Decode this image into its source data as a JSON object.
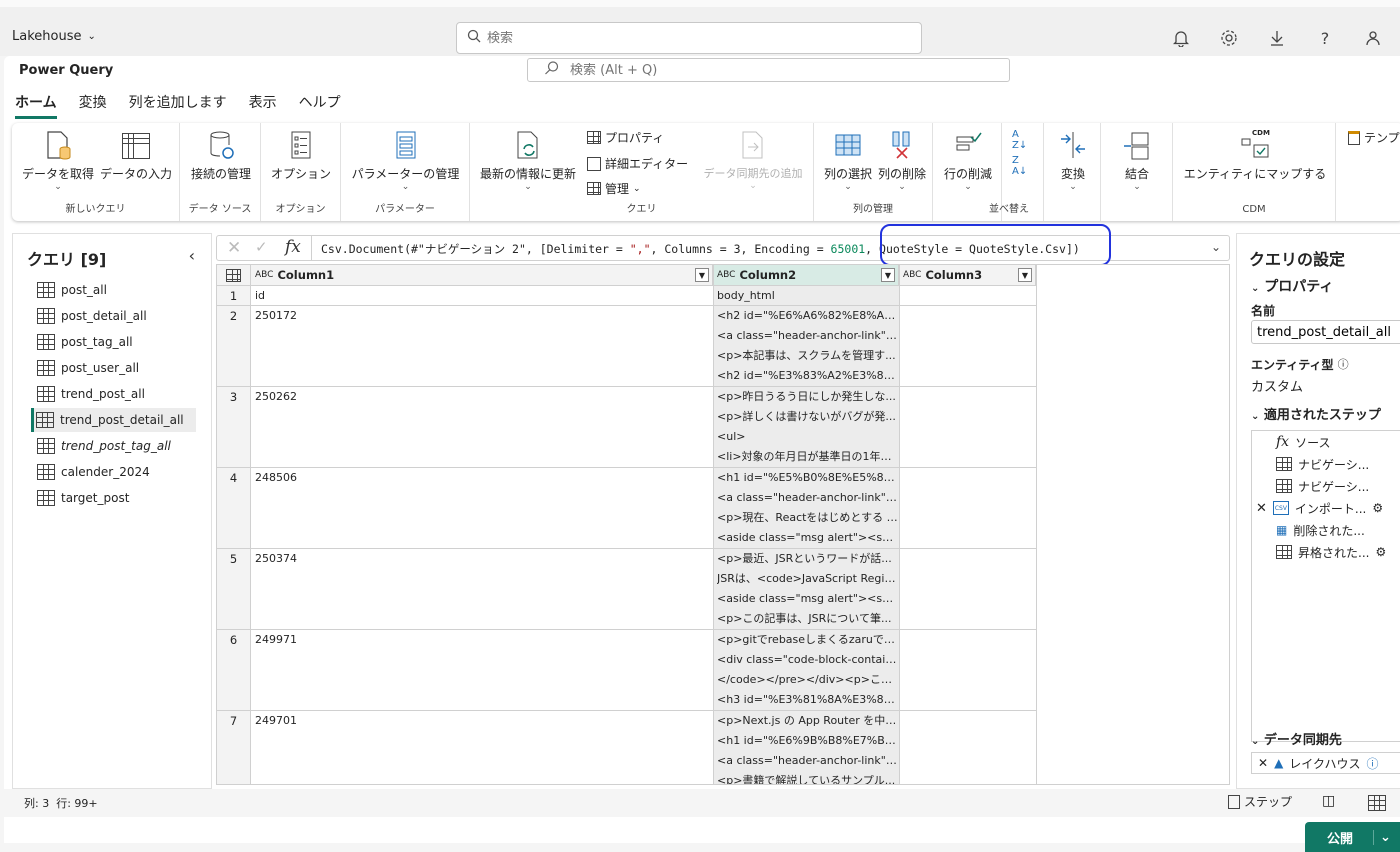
{
  "topbar": {
    "workspace": "Lakehouse",
    "search_placeholder": "検索"
  },
  "pq": {
    "title": "Power Query",
    "search_placeholder": "検索 (Alt + Q)"
  },
  "tabs": [
    "ホーム",
    "変換",
    "列を追加します",
    "表示",
    "ヘルプ"
  ],
  "ribbon": {
    "get_data": "データを取得",
    "enter_data": "データの入力",
    "group_new_query": "新しいクエリ",
    "manage_connections": "接続の管理",
    "group_data_source": "データ ソース",
    "options": "オプション",
    "group_options": "オプション",
    "manage_params": "パラメーターの管理",
    "group_params": "パラメーター",
    "refresh": "最新の情報に更新",
    "properties": "プロパティ",
    "advanced_editor": "詳細エディター",
    "manage": "管理",
    "add_sync_dest": "データ同期先の追加",
    "group_query": "クエリ",
    "choose_columns": "列の選択",
    "remove_columns": "列の削除",
    "group_manage_columns": "列の管理",
    "reduce_rows": "行の削減",
    "group_sort": "並べ替え",
    "transform": "変換",
    "combine": "結合",
    "map_entity": "エンティティにマップする",
    "group_cdm": "CDM",
    "cdm_badge": "CDM",
    "template": "テンプ"
  },
  "queries": {
    "title": "クエリ [9]",
    "items": [
      "post_all",
      "post_detail_all",
      "post_tag_all",
      "post_user_all",
      "trend_post_all",
      "trend_post_detail_all",
      "trend_post_tag_all",
      "calender_2024",
      "target_post"
    ]
  },
  "formula": {
    "fx": "fx",
    "p1": "Csv.Document(#\"ナビゲーション 2\", [Delimiter = ",
    "p2": "\",\"",
    "p3": ", Columns = 3, Encoding = ",
    "p4": "65001",
    "p5": ", QuoteStyle = QuoteStyle.Csv])"
  },
  "grid": {
    "type_badge": "ABC",
    "columns": [
      "Column1",
      "Column2",
      "Column3"
    ],
    "rows": [
      {
        "n": "1",
        "c1": "id",
        "c2": [
          "body_html"
        ]
      },
      {
        "n": "2",
        "c1": "250172",
        "c2": [
          "<h2 id=\"%E6%A6%82%E8%A6...",
          "<a class=\"header-anchor-link\" h...",
          "<p>本記事は、スクラムを管理す...",
          "<h2 id=\"%E3%83%A2%E3%83..."
        ]
      },
      {
        "n": "3",
        "c1": "250262",
        "c2": [
          "<p>昨日うるう日にしか発生しな...",
          "<p>詳しくは書けないがバグが発...",
          "<ul>",
          "<li>対象の年月日が基準日の1年前..."
        ]
      },
      {
        "n": "4",
        "c1": "248506",
        "c2": [
          "<h1 id=\"%E5%B0%8E%E5%85...",
          "<a class=\"header-anchor-link\" h...",
          "<p>現在、Reactをはじめとする V...",
          "<aside class=\"msg alert\"><span..."
        ]
      },
      {
        "n": "5",
        "c1": "250374",
        "c2": [
          "<p>最近、JSRというワードが話...",
          "JSRは、<code>JavaScript Regis...",
          "<aside class=\"msg alert\"><span...",
          "<p>この記事は、JSRについて筆..."
        ]
      },
      {
        "n": "6",
        "c1": "249971",
        "c2": [
          "<p>gitでrebaseしまくるzaruです...",
          "<div class=\"code-block-contain...",
          "</code></pre></div><p>これだ...",
          "<h3 id=\"%E3%81%8A%E3%81..."
        ]
      },
      {
        "n": "7",
        "c1": "249701",
        "c2": [
          "<p>Next.js の App Router を中心...",
          "<h1 id=\"%E6%9B%B8%E7%B1...",
          "<a class=\"header-anchor-link\" h...",
          "<p>書籍で解説しているサンプル..."
        ]
      }
    ]
  },
  "settings": {
    "title": "クエリの設定",
    "properties": "プロパティ",
    "name_label": "名前",
    "name_value": "trend_post_detail_all",
    "entity_label": "エンティティ型",
    "entity_value": "カスタム",
    "steps_title": "適用されたステップ",
    "steps": [
      "ソース",
      "ナビゲーシ...",
      "ナビゲーシ...",
      "インポート...",
      "削除された...",
      "昇格された..."
    ],
    "csv_badge": "CSV",
    "sync_title": "データ同期先",
    "sync_value": "レイクハウス"
  },
  "status": {
    "counts": "列: 3  行: 99+",
    "steps": "ステップ",
    "publish": "公開"
  }
}
